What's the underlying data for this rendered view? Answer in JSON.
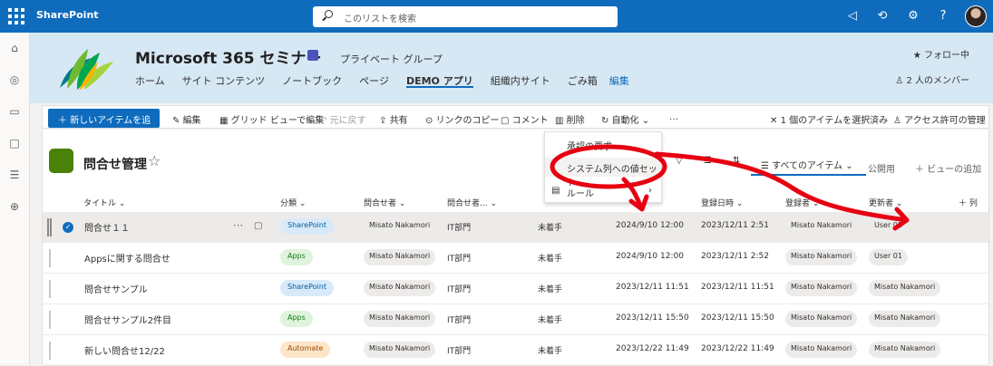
{
  "app": {
    "name": "SharePoint"
  },
  "search": {
    "placeholder": "このリストを検索"
  },
  "site": {
    "title": "Microsoft 365 セミナー",
    "group_label": "プライベート グループ",
    "follow": "フォロー中",
    "members": "2 人のメンバー",
    "nav": [
      "ホーム",
      "サイト コンテンツ",
      "ノートブック",
      "ページ",
      "DEMO アプリ",
      "組織内サイト",
      "ごみ箱",
      "編集"
    ]
  },
  "commands": {
    "new_item": "新しいアイテムを追加",
    "edit": "編集",
    "grid_edit": "グリッド ビューで編集",
    "undo": "元に戻す",
    "share": "共有",
    "copy_link": "リンクのコピー",
    "comment": "コメント",
    "delete": "削除",
    "automate": "自動化",
    "more": "…",
    "selected": "1 個のアイテムを選択済み",
    "access": "アクセス許可の管理"
  },
  "list": {
    "title": "問合せ管理",
    "view": "すべてのアイテム",
    "public": "公開用",
    "add_view": "ビューの追加",
    "columns": [
      "タイトル",
      "分類",
      "問合せ者",
      "問合せ者...",
      "",
      "登録日時",
      "登録者",
      "更新者",
      "列"
    ],
    "rows": [
      {
        "title": "問合せ１１",
        "category": "SharePoint",
        "person": "Misato Nakamori",
        "dept": "IT部門",
        "status": "未着手",
        "date1": "2024/9/10 12:00",
        "date2": "2023/12/11 2:51",
        "creator": "Misato Nakamori",
        "updater": "User 01"
      },
      {
        "title": "Appsに関する問合せ",
        "category": "Apps",
        "person": "Misato Nakamori",
        "dept": "IT部門",
        "status": "未着手",
        "date1": "2024/9/10 12:00",
        "date2": "2023/12/11 2:52",
        "creator": "Misato Nakamori",
        "updater": "User 01"
      },
      {
        "title": "問合せサンプル",
        "category": "SharePoint",
        "person": "Misato Nakamori",
        "dept": "IT部門",
        "status": "未着手",
        "date1": "2023/12/11 11:51",
        "date2": "2023/12/11 11:51",
        "creator": "Misato Nakamori",
        "updater": "Misato Nakamori"
      },
      {
        "title": "問合せサンプル2件目",
        "category": "Apps",
        "person": "Misato Nakamori",
        "dept": "IT部門",
        "status": "未着手",
        "date1": "2023/12/11 15:50",
        "date2": "2023/12/11 15:50",
        "creator": "Misato Nakamori",
        "updater": "Misato Nakamori"
      },
      {
        "title": "新しい問合せ12/22",
        "category": "Automate",
        "person": "Misato Nakamori",
        "dept": "IT部門",
        "status": "未着手",
        "date1": "2023/12/22 11:49",
        "date2": "2023/12/22 11:49",
        "creator": "Misato Nakamori",
        "updater": "Misato Nakamori"
      }
    ]
  },
  "menu": {
    "items": [
      "承認の要求",
      "システム列への値セット",
      "ルール"
    ]
  },
  "colors": {
    "brand": "#0f6cbd",
    "annotation": "#e60012"
  },
  "icons": [
    "waffle-icon",
    "search-icon",
    "megaphone-icon",
    "settings-icon",
    "help-icon",
    "star-icon",
    "edit-icon",
    "grid-icon",
    "undo-icon",
    "share-icon",
    "link-icon",
    "comment-icon",
    "delete-icon",
    "automate-icon",
    "close-icon",
    "person-icon",
    "filter-icon",
    "sort-icon",
    "rule-icon"
  ]
}
